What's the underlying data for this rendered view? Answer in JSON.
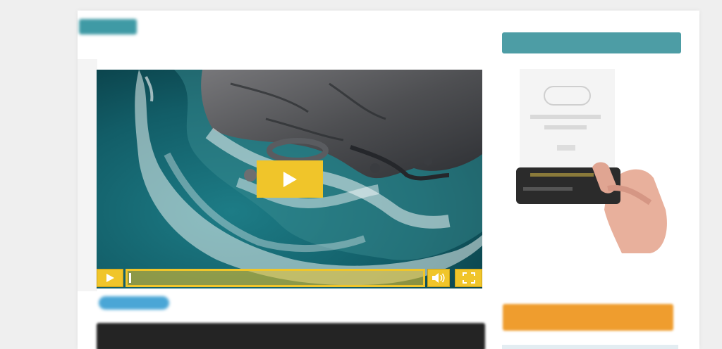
{
  "page": {
    "top_tag": "",
    "subtitle": "",
    "bottom_tag": ""
  },
  "video": {
    "big_play_icon": "play-icon",
    "controls": {
      "play_icon": "play-icon",
      "progress_fraction": 0.0,
      "volume_icon": "volume-icon",
      "fullscreen_icon": "fullscreen-icon"
    },
    "accent_color": "#f0c52a"
  },
  "sidebar": {
    "header_text": "",
    "promo_text": "",
    "cta_label": "",
    "header_color": "#4d9da5",
    "cta_color": "#ef9d2e"
  }
}
